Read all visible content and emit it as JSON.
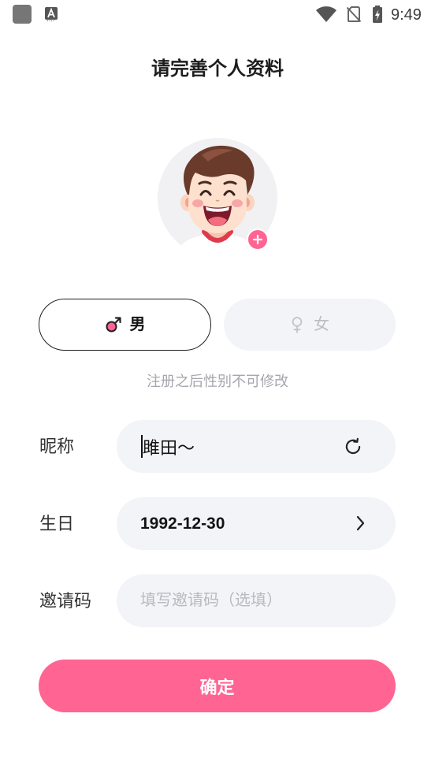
{
  "status_bar": {
    "time": "9:49",
    "left_icons": [
      "app-notification-icon",
      "keyboard-a-icon"
    ],
    "right_icons": [
      "wifi-icon",
      "no-sim-icon",
      "battery-charging-icon"
    ]
  },
  "header": {
    "title": "请完善个人资料"
  },
  "avatar": {
    "image": "cartoon-boy-avatar",
    "add_icon": "plus-icon"
  },
  "gender": {
    "options": [
      {
        "label": "男",
        "icon": "male-icon",
        "selected": true
      },
      {
        "label": "女",
        "icon": "female-icon",
        "selected": false
      }
    ],
    "hint": "注册之后性别不可修改"
  },
  "form": {
    "nickname": {
      "label": "昵称",
      "value": "雎田～",
      "action_icon": "refresh-icon"
    },
    "birthday": {
      "label": "生日",
      "value": "1992-12-30",
      "action_icon": "chevron-right-icon"
    },
    "invite_code": {
      "label": "邀请码",
      "value": "",
      "placeholder": "填写邀请码（选填）"
    }
  },
  "confirm_button": {
    "label": "确定"
  },
  "colors": {
    "accent": "#ff6493",
    "field_background": "#f3f4f8",
    "label_text": "#333333",
    "hint_text": "#a6a6ae"
  }
}
